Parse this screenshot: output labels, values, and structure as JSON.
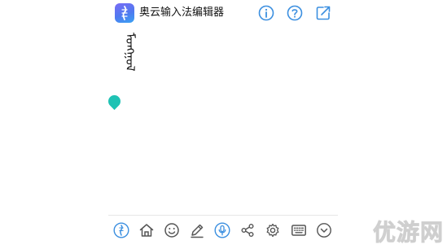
{
  "header": {
    "title": "奥云输入法编辑器",
    "app_icon": "app-logo-icon",
    "actions": [
      {
        "name": "info-icon"
      },
      {
        "name": "help-icon"
      },
      {
        "name": "share-export-icon"
      }
    ]
  },
  "editor": {
    "text": "ᠮᠣᠩᠭᠣᠯ",
    "cursor_color": "#1fc2b4"
  },
  "toolbar": {
    "items": [
      {
        "name": "mongol-input-icon"
      },
      {
        "name": "home-icon"
      },
      {
        "name": "emoji-icon"
      },
      {
        "name": "pencil-icon"
      },
      {
        "name": "voice-icon"
      },
      {
        "name": "share-icon"
      },
      {
        "name": "settings-gear-icon"
      },
      {
        "name": "keyboard-icon"
      },
      {
        "name": "chevron-down-icon"
      }
    ]
  },
  "watermark": "优游网",
  "colors": {
    "accent": "#3b8fe0",
    "cursor": "#1fc2b4",
    "icon_gray": "#555555"
  }
}
